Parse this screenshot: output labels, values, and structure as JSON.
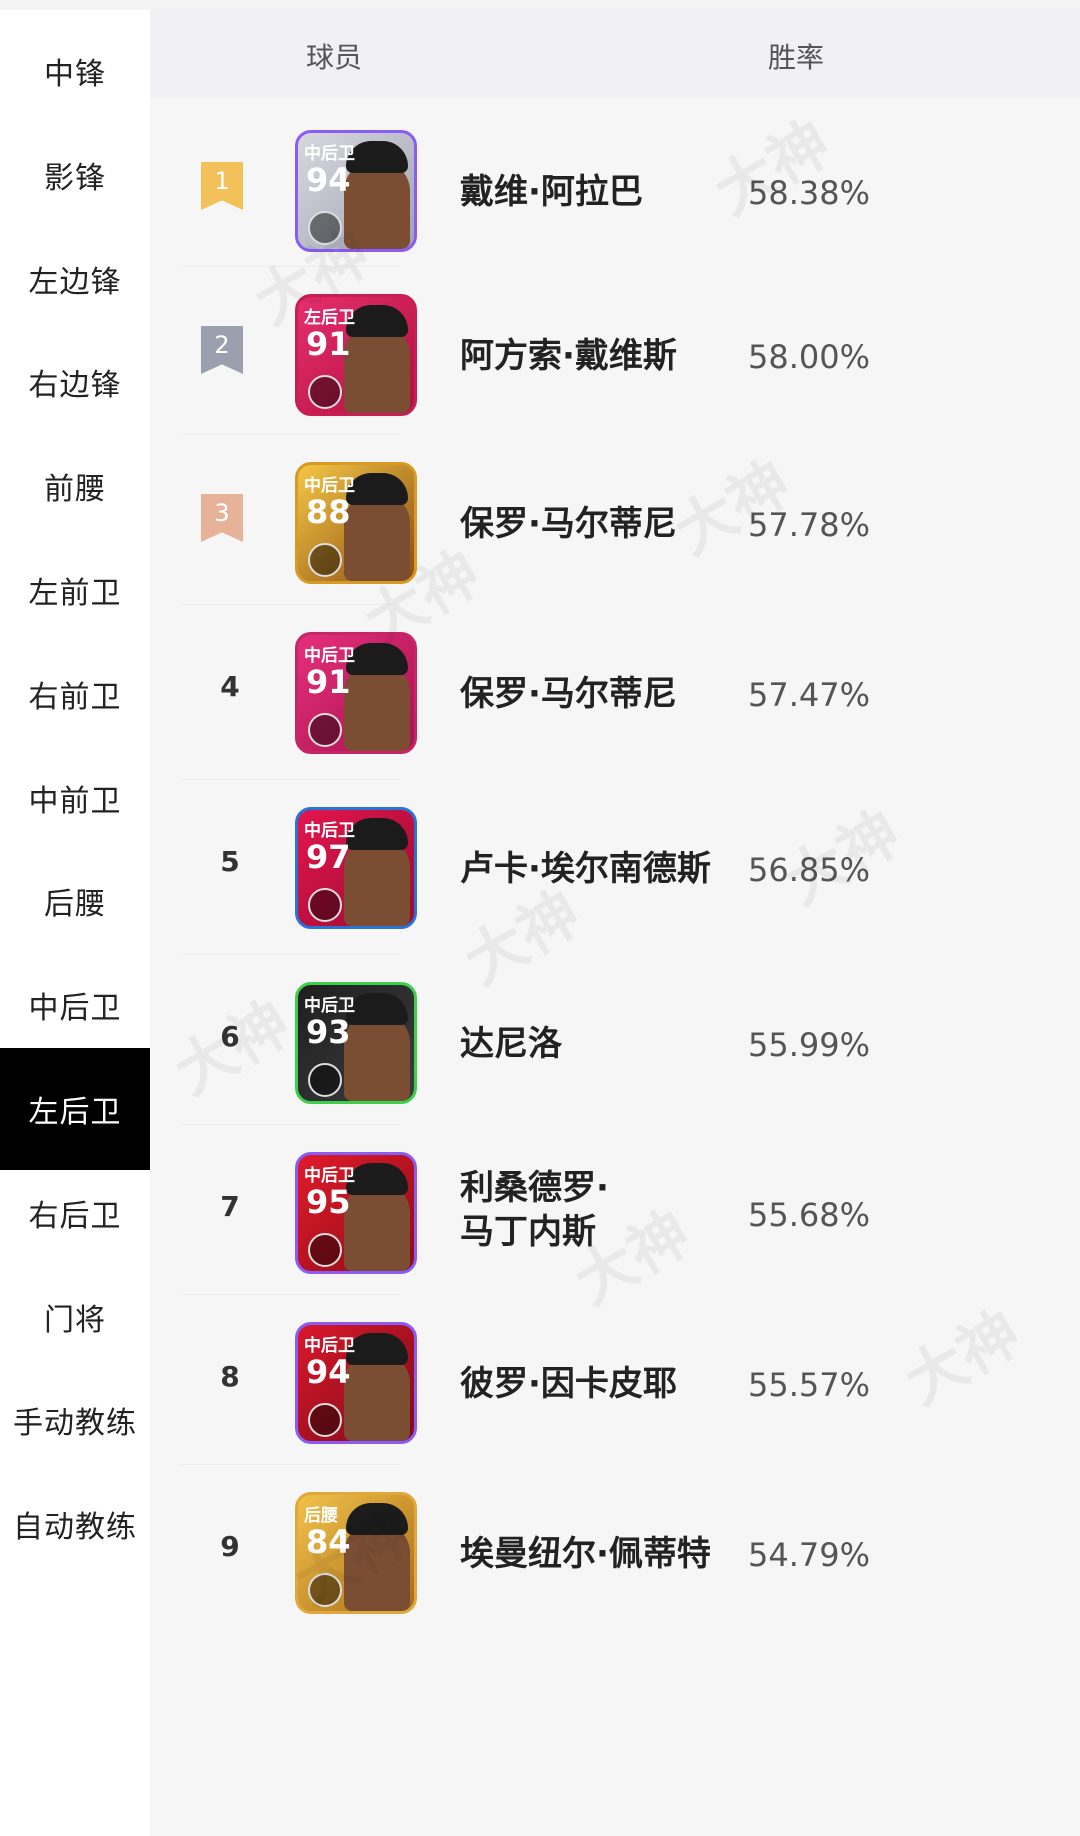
{
  "sidebar": {
    "items": [
      {
        "label": "中锋",
        "active": false
      },
      {
        "label": "影锋",
        "active": false
      },
      {
        "label": "左边锋",
        "active": false
      },
      {
        "label": "右边锋",
        "active": false
      },
      {
        "label": "前腰",
        "active": false
      },
      {
        "label": "左前卫",
        "active": false
      },
      {
        "label": "右前卫",
        "active": false
      },
      {
        "label": "中前卫",
        "active": false
      },
      {
        "label": "后腰",
        "active": false
      },
      {
        "label": "中后卫",
        "active": false
      },
      {
        "label": "左后卫",
        "active": true
      },
      {
        "label": "右后卫",
        "active": false
      },
      {
        "label": "门将",
        "active": false
      },
      {
        "label": "手动教练",
        "active": false
      },
      {
        "label": "自动教练",
        "active": false
      }
    ]
  },
  "table": {
    "header": {
      "player": "球员",
      "win_rate": "胜率"
    },
    "rows": [
      {
        "rank": "1",
        "position": "中后卫",
        "rating": "94",
        "name": "戴维·阿拉巴",
        "win_rate": "58.38%"
      },
      {
        "rank": "2",
        "position": "左后卫",
        "rating": "91",
        "name": "阿方索·戴维斯",
        "win_rate": "58.00%"
      },
      {
        "rank": "3",
        "position": "中后卫",
        "rating": "88",
        "name": "保罗·马尔蒂尼",
        "win_rate": "57.78%"
      },
      {
        "rank": "4",
        "position": "中后卫",
        "rating": "91",
        "name": "保罗·马尔蒂尼",
        "win_rate": "57.47%"
      },
      {
        "rank": "5",
        "position": "中后卫",
        "rating": "97",
        "name": "卢卡·埃尔南德斯",
        "win_rate": "56.85%"
      },
      {
        "rank": "6",
        "position": "中后卫",
        "rating": "93",
        "name": "达尼洛",
        "win_rate": "55.99%"
      },
      {
        "rank": "7",
        "position": "中后卫",
        "rating": "95",
        "name": "利桑德罗·\n马丁内斯",
        "win_rate": "55.68%"
      },
      {
        "rank": "8",
        "position": "中后卫",
        "rating": "94",
        "name": "彼罗·因卡皮耶",
        "win_rate": "55.57%"
      },
      {
        "rank": "9",
        "position": "后腰",
        "rating": "84",
        "name": "埃曼纽尔·佩蒂特",
        "win_rate": "54.79%"
      }
    ]
  },
  "watermark": "大神",
  "colors": {
    "active_bg": "#000000",
    "rank1": "#f3c15a",
    "rank2": "#9aa0ad",
    "rank3": "#e6b39a"
  }
}
